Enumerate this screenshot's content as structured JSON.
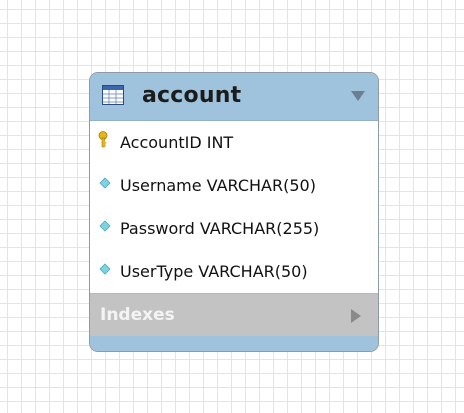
{
  "table": {
    "name": "account",
    "columns": [
      {
        "name": "AccountID INT",
        "icon": "primary-key-icon"
      },
      {
        "name": "Username VARCHAR(50)",
        "icon": "column-diamond-icon"
      },
      {
        "name": "Password VARCHAR(255)",
        "icon": "column-diamond-icon"
      },
      {
        "name": "UserType VARCHAR(50)",
        "icon": "column-diamond-icon"
      }
    ],
    "indexes_label": "Indexes"
  },
  "colors": {
    "header": "#9fc3dc",
    "indexes_band": "#c3c3c3",
    "key_icon": "#e8b418",
    "diamond_icon": "#7fd3e0"
  }
}
